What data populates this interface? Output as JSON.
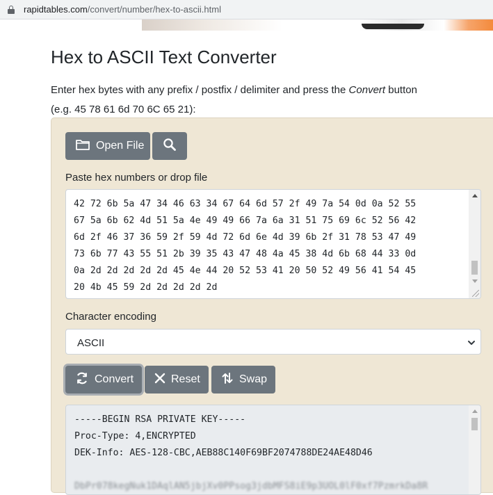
{
  "browser": {
    "url_domain": "rapidtables.com",
    "url_path": "/convert/number/hex-to-ascii.html"
  },
  "page": {
    "title": "Hex to ASCII Text Converter",
    "desc_before": "Enter hex bytes with any prefix / postfix / delimiter and press the ",
    "desc_em": "Convert",
    "desc_after": " button",
    "example": "(e.g. 45 78 61 6d 70 6C 65 21):"
  },
  "toolbar": {
    "open_file_label": "Open File",
    "search_icon": "search-icon",
    "folder_icon": "folder-icon"
  },
  "input": {
    "label": "Paste hex numbers or drop file",
    "lines": [
      "42 72 6b 5a 47 34 46 63 34 67 64 6d 57 2f 49 7a 54 0d 0a 52 55",
      "67 5a 6b 62 4d 51 5a 4e 49 49 66 7a 6a 31 51 75 69 6c 52 56 42",
      "6d 2f 46 37 36 59 2f 59 4d 72 6d 6e 4d 39 6b 2f 31 78 53 47 49",
      "73 6b 77 43 55 51 2b 39 35 43 47 48 4a 45 38 4d 6b 68 44 33 0d",
      "0a 2d 2d 2d 2d 2d 45 4e 44 20 52 53 41 20 50 52 49 56 41 54 45",
      "20 4b 45 59 2d 2d 2d 2d 2d"
    ],
    "scroll_position": 0.93
  },
  "encoding": {
    "label": "Character encoding",
    "selected": "ASCII"
  },
  "actions": {
    "convert_label": "Convert",
    "reset_label": "Reset",
    "swap_label": "Swap"
  },
  "output": {
    "lines": [
      "-----BEGIN RSA PRIVATE KEY-----",
      "Proc-Type: 4,ENCRYPTED",
      "DEK-Info: AES-128-CBC,AEB88C140F69BF2074788DE24AE48D46",
      "",
      "DbPr078kegNuk1DAqlAN5jbjXv0PPsog3jdbMFS8iE9p3UOL0lF0xf7PzmrkDa8R"
    ]
  },
  "colors": {
    "panel_bg": "#efe7d5",
    "button_bg": "#6c757d",
    "output_bg": "#e9ecef"
  }
}
